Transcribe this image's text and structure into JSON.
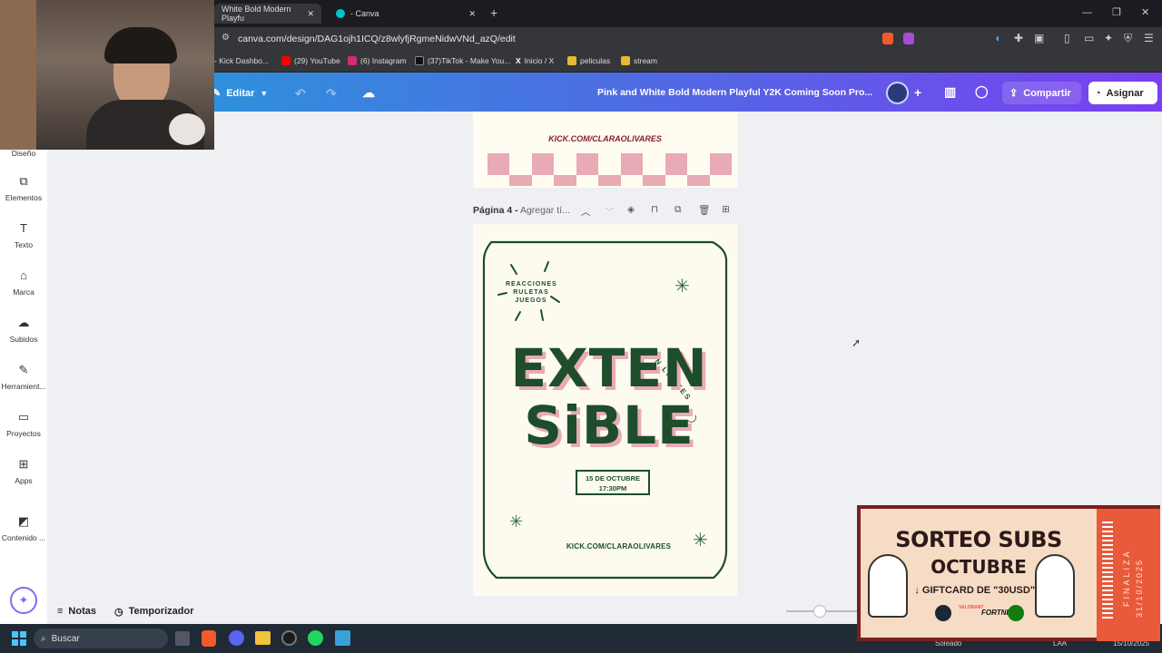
{
  "browser": {
    "tabs": [
      {
        "label": "White Bold Modern Playfu",
        "active": true
      },
      {
        "label": "- Canva",
        "active": false
      }
    ],
    "url": "canva.com/design/DAG1ojh1ICQ/z8wlyfjRgmeNidwVNd_azQ/edit",
    "bookmarks": [
      {
        "label": "- Kick Dashbo...",
        "color": "#53fc18"
      },
      {
        "label": "(29) YouTube",
        "color": "#ff0000"
      },
      {
        "label": "(6) Instagram",
        "color": "#d62976"
      },
      {
        "label": "(37)TikTok - Make You...",
        "color": "#111111"
      },
      {
        "label": "Inicio / X",
        "color": "#000000"
      },
      {
        "label": "peliculas",
        "color": "#e8b931"
      },
      {
        "label": "stream",
        "color": "#e8b931"
      }
    ]
  },
  "canva": {
    "edit_label": "Editar",
    "doc_title": "Pink and White Bold Modern Playful Y2K Coming Soon Pro...",
    "share_label": "Compartir",
    "assign_label": "Asignar",
    "sidebar": [
      {
        "label": "Diseño",
        "icon": "layout-icon"
      },
      {
        "label": "Elementos",
        "icon": "elements-icon"
      },
      {
        "label": "Texto",
        "icon": "text-icon"
      },
      {
        "label": "Marca",
        "icon": "brand-icon"
      },
      {
        "label": "Subidos",
        "icon": "upload-icon"
      },
      {
        "label": "Herramient...",
        "icon": "tools-icon"
      },
      {
        "label": "Proyectos",
        "icon": "folder-icon"
      },
      {
        "label": "Apps",
        "icon": "apps-icon"
      },
      {
        "label": "Contenido ...",
        "icon": "content-icon"
      }
    ],
    "page_label": "Página 4 -",
    "page_title_placeholder": "Agregar tí...",
    "notes_label": "Notas",
    "timer_label": "Temporizador"
  },
  "design_prev": {
    "link": "KICK.COM/CLARAOLIVARES"
  },
  "design": {
    "top_text": [
      "REACCIONES",
      "RULETAS",
      "JUEGOS"
    ],
    "curved_text": "SIN LIMITES",
    "title_line1": "EXTEN",
    "title_line2": "SiBLE",
    "date": "15 DE OCTUBRE",
    "time": "17:30PM",
    "link": "KICK.COM/CLARAOLIVARES",
    "green": "#1e4d2b",
    "pink": "#e8aab5"
  },
  "overlay": {
    "title1": "SORTEO SUBS",
    "title2": "OCTUBRE",
    "giftcard": "↓ GIFTCARD DE \"30USD\" ↓",
    "side_label": "FINALIZA",
    "side_date": "31/10/2025",
    "brands": [
      "VALORANT",
      "FORTNITE"
    ]
  },
  "taskbar": {
    "search_placeholder": "Buscar",
    "weather": "Soleado",
    "lang": "LAA",
    "date": "15/10/2025"
  }
}
